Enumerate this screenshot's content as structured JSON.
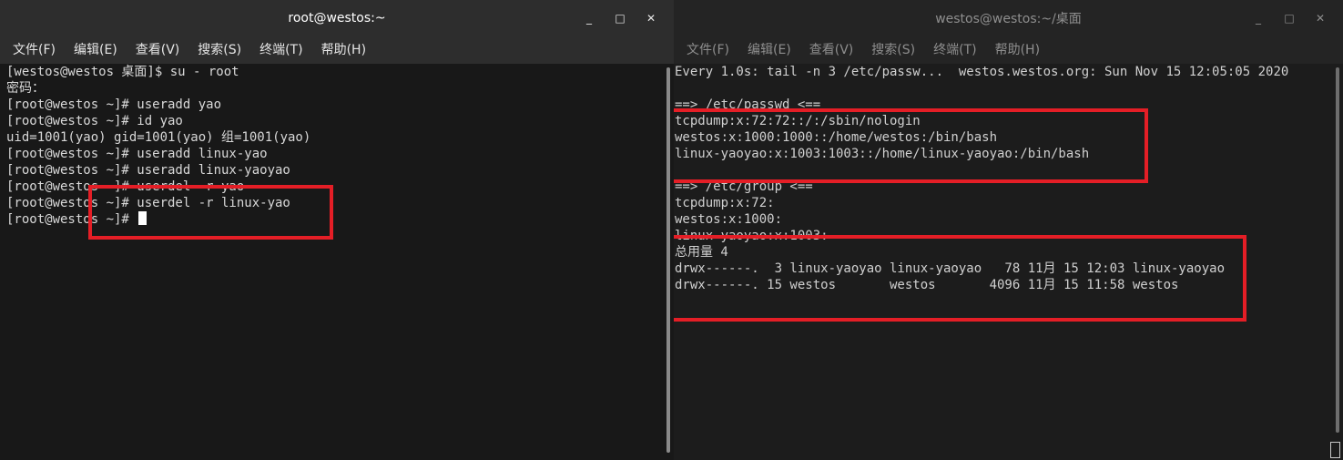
{
  "left": {
    "title": "root@westos:~",
    "menu": [
      "文件(F)",
      "编辑(E)",
      "查看(V)",
      "搜索(S)",
      "终端(T)",
      "帮助(H)"
    ],
    "lines": [
      "[westos@westos 桌面]$ su - root",
      "密码：",
      "[root@westos ~]# useradd yao",
      "[root@westos ~]# id yao",
      "uid=1001(yao) gid=1001(yao) 组=1001(yao)",
      "[root@westos ~]# useradd linux-yao",
      "[root@westos ~]# useradd linux-yaoyao",
      "[root@westos ~]# userdel -r yao",
      "[root@westos ~]# userdel -r linux-yao",
      "[root@westos ~]# "
    ]
  },
  "right": {
    "title": "westos@westos:~/桌面",
    "menu": [
      "文件(F)",
      "编辑(E)",
      "查看(V)",
      "搜索(S)",
      "终端(T)",
      "帮助(H)"
    ],
    "lines": [
      "Every 1.0s: tail -n 3 /etc/passw...  westos.westos.org: Sun Nov 15 12:05:05 2020",
      "",
      "==> /etc/passwd <==",
      "tcpdump:x:72:72::/:/sbin/nologin",
      "westos:x:1000:1000::/home/westos:/bin/bash",
      "linux-yaoyao:x:1003:1003::/home/linux-yaoyao:/bin/bash",
      "",
      "==> /etc/group <==",
      "tcpdump:x:72:",
      "westos:x:1000:",
      "linux-yaoyao:x:1003:",
      "总用量 4",
      "drwx------.  3 linux-yaoyao linux-yaoyao   78 11月 15 12:03 linux-yaoyao",
      "drwx------. 15 westos       westos       4096 11月 15 11:58 westos"
    ]
  },
  "window_controls": {
    "minimize": "_",
    "maximize": "□",
    "close": "✕"
  },
  "highlight_color": "#e41e26"
}
